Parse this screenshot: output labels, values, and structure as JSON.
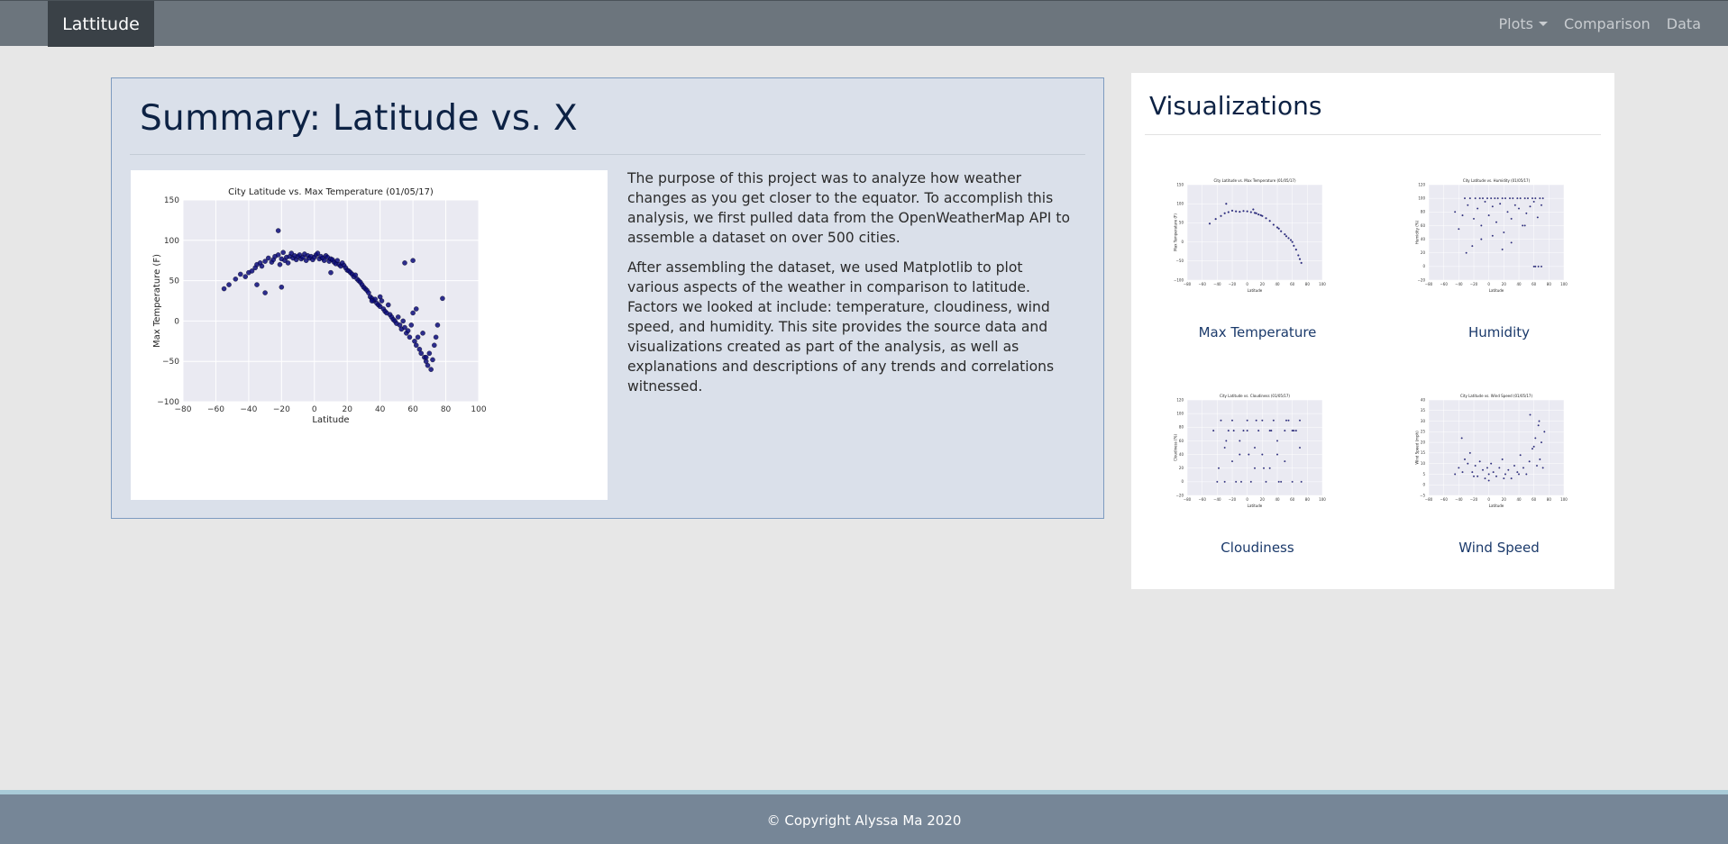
{
  "navbar": {
    "brand": "Lattitude",
    "links": [
      {
        "label": "Plots"
      },
      {
        "label": "Comparison"
      },
      {
        "label": "Data"
      }
    ]
  },
  "summary": {
    "title": "Summary: Latitude vs. X",
    "paragraphs": [
      "The purpose of this project was to analyze how weather changes as you get closer to the equator. To accomplish this analysis, we first pulled data from the OpenWeatherMap API to assemble a dataset on over 500 cities.",
      "After assembling the dataset, we used Matplotlib to plot various aspects of the weather in comparison to latitude. Factors we looked at include: temperature, cloudiness, wind speed, and humidity. This site provides the source data and visualizations created as part of the analysis, as well as explanations and descriptions of any trends and correlations witnessed."
    ]
  },
  "visualizations": {
    "title": "Visualizations",
    "items": [
      {
        "label": "Max Temperature"
      },
      {
        "label": "Humidity"
      },
      {
        "label": "Cloudiness"
      },
      {
        "label": "Wind Speed"
      }
    ]
  },
  "footer": {
    "text": "© Copyright Alyssa Ma 2020"
  },
  "colors": {
    "point": "#0b0b7a",
    "plot_bg": "#eaeaf2",
    "grid": "#ffffff"
  },
  "chart_data": [
    {
      "type": "scatter",
      "title": "City Latitude vs. Max Temperature (01/05/17)",
      "xlabel": "Latitude",
      "ylabel": "Max Temperature (F)",
      "xlim": [
        -80,
        100
      ],
      "ylim": [
        -100,
        150
      ],
      "xticks": [
        -80,
        -60,
        -40,
        -20,
        0,
        20,
        40,
        60,
        80,
        100
      ],
      "yticks": [
        -100,
        -50,
        0,
        50,
        100,
        150
      ],
      "trend": "peaks near 80 F around latitude 0-10, dropping toward -50 F near latitude 70",
      "x": [
        -55,
        -52,
        -48,
        -45,
        -42,
        -40,
        -38,
        -36,
        -35,
        -33,
        -32,
        -30,
        -28,
        -26,
        -25,
        -24,
        -22,
        -21,
        -20,
        -19,
        -18,
        -17,
        -16,
        -15,
        -14,
        -13,
        -12,
        -11,
        -10,
        -9,
        -8,
        -7,
        -6,
        -5,
        -4,
        -3,
        -2,
        -1,
        0,
        1,
        2,
        3,
        4,
        5,
        6,
        7,
        8,
        9,
        10,
        11,
        12,
        13,
        14,
        15,
        16,
        17,
        18,
        19,
        20,
        21,
        22,
        23,
        24,
        25,
        26,
        27,
        28,
        29,
        30,
        31,
        32,
        33,
        34,
        35,
        36,
        37,
        38,
        39,
        40,
        41,
        42,
        43,
        44,
        45,
        46,
        47,
        48,
        49,
        50,
        51,
        52,
        53,
        54,
        55,
        56,
        57,
        58,
        59,
        60,
        61,
        62,
        63,
        64,
        65,
        66,
        67,
        68,
        69,
        70,
        71,
        72,
        73,
        74,
        75,
        78,
        -22,
        -30,
        -35,
        -20,
        10,
        60,
        55,
        40,
        35,
        62,
        68
      ],
      "y": [
        40,
        45,
        52,
        58,
        55,
        60,
        62,
        66,
        70,
        72,
        68,
        74,
        78,
        73,
        76,
        80,
        82,
        70,
        77,
        85,
        75,
        79,
        72,
        80,
        84,
        78,
        81,
        76,
        80,
        82,
        77,
        79,
        83,
        75,
        81,
        78,
        80,
        76,
        79,
        82,
        84,
        77,
        80,
        78,
        75,
        81,
        79,
        74,
        77,
        76,
        73,
        71,
        75,
        70,
        68,
        72,
        69,
        66,
        63,
        62,
        60,
        58,
        55,
        57,
        52,
        50,
        48,
        45,
        42,
        40,
        38,
        35,
        30,
        28,
        25,
        27,
        22,
        20,
        18,
        25,
        15,
        12,
        10,
        20,
        8,
        5,
        2,
        0,
        -3,
        5,
        -5,
        -10,
        0,
        -8,
        -15,
        -12,
        -20,
        -5,
        10,
        -25,
        -30,
        -20,
        -35,
        -40,
        -15,
        -45,
        -50,
        -55,
        -40,
        -60,
        -48,
        -30,
        -20,
        -5,
        28,
        112,
        35,
        45,
        42,
        60,
        75,
        72,
        30,
        25,
        15,
        -45
      ]
    },
    {
      "type": "scatter",
      "title": "City Latitude vs. Max Temperature (01/05/17)",
      "xlabel": "Latitude",
      "ylabel": "Max Temperature (F)",
      "xlim": [
        -80,
        100
      ],
      "ylim": [
        -100,
        150
      ],
      "x": [
        -50,
        -42,
        -35,
        -30,
        -25,
        -20,
        -15,
        -10,
        -5,
        0,
        5,
        10,
        15,
        20,
        25,
        30,
        35,
        40,
        45,
        50,
        55,
        60,
        65,
        68,
        70,
        72,
        -28,
        8,
        12,
        18,
        42,
        52,
        58,
        62
      ],
      "y": [
        48,
        60,
        68,
        75,
        78,
        82,
        80,
        79,
        81,
        80,
        78,
        76,
        72,
        68,
        62,
        55,
        45,
        38,
        28,
        20,
        10,
        0,
        -20,
        -35,
        -45,
        -55,
        100,
        85,
        75,
        70,
        35,
        15,
        5,
        -10
      ]
    },
    {
      "type": "scatter",
      "title": "City Latitude vs. Humidity (01/05/17)",
      "xlabel": "Latitude",
      "ylabel": "Humidity (%)",
      "xlim": [
        -80,
        100
      ],
      "ylim": [
        -20,
        120
      ],
      "x": [
        -45,
        -40,
        -35,
        -32,
        -28,
        -25,
        -20,
        -18,
        -15,
        -12,
        -10,
        -8,
        -5,
        -2,
        0,
        3,
        5,
        8,
        10,
        12,
        15,
        18,
        20,
        22,
        25,
        28,
        30,
        32,
        35,
        38,
        40,
        42,
        45,
        48,
        50,
        52,
        55,
        58,
        60,
        62,
        65,
        68,
        70,
        72,
        -30,
        -22,
        -10,
        5,
        18,
        30,
        48,
        60,
        62,
        66,
        70
      ],
      "y": [
        80,
        55,
        75,
        100,
        90,
        100,
        70,
        100,
        85,
        100,
        60,
        100,
        95,
        100,
        75,
        100,
        88,
        100,
        65,
        100,
        92,
        100,
        50,
        100,
        80,
        100,
        70,
        100,
        90,
        100,
        85,
        100,
        60,
        100,
        78,
        100,
        88,
        100,
        95,
        100,
        72,
        100,
        90,
        100,
        20,
        30,
        40,
        45,
        25,
        35,
        60,
        0,
        0,
        0,
        0
      ]
    },
    {
      "type": "scatter",
      "title": "City Latitude vs. Cloudiness (01/05/17)",
      "xlabel": "Latitude",
      "ylabel": "Cloudiness (%)",
      "xlim": [
        -80,
        100
      ],
      "ylim": [
        -20,
        120
      ],
      "x": [
        -45,
        -40,
        -35,
        -30,
        -25,
        -20,
        -15,
        -10,
        -5,
        0,
        5,
        10,
        15,
        20,
        25,
        30,
        35,
        40,
        45,
        50,
        55,
        60,
        65,
        70,
        -38,
        -28,
        -18,
        -8,
        2,
        12,
        22,
        32,
        42,
        52,
        62,
        72,
        -30,
        -20,
        -10,
        0,
        10,
        20,
        30,
        40,
        50,
        60,
        70
      ],
      "y": [
        75,
        0,
        90,
        0,
        75,
        90,
        0,
        40,
        75,
        90,
        0,
        20,
        75,
        90,
        0,
        75,
        90,
        40,
        0,
        75,
        90,
        0,
        75,
        90,
        20,
        60,
        75,
        0,
        40,
        90,
        20,
        75,
        0,
        90,
        75,
        0,
        50,
        30,
        60,
        75,
        50,
        40,
        20,
        60,
        30,
        75,
        50
      ]
    },
    {
      "type": "scatter",
      "title": "City Latitude vs. Wind Speed (01/05/17)",
      "xlabel": "Latitude",
      "ylabel": "Wind Speed (mph)",
      "xlim": [
        -80,
        100
      ],
      "ylim": [
        -5,
        40
      ],
      "x": [
        -45,
        -40,
        -36,
        -32,
        -28,
        -25,
        -22,
        -18,
        -15,
        -12,
        -8,
        -5,
        -2,
        0,
        3,
        6,
        10,
        14,
        18,
        22,
        26,
        30,
        34,
        38,
        42,
        46,
        50,
        54,
        58,
        62,
        64,
        66,
        68,
        70,
        72,
        74,
        -35,
        -20,
        0,
        20,
        40,
        55,
        60,
        67
      ],
      "y": [
        5,
        8,
        22,
        12,
        10,
        15,
        6,
        9,
        4,
        11,
        7,
        3,
        8,
        5,
        10,
        6,
        4,
        8,
        12,
        5,
        7,
        3,
        9,
        6,
        14,
        8,
        5,
        11,
        17,
        22,
        9,
        28,
        12,
        20,
        8,
        25,
        6,
        4,
        2,
        3,
        5,
        33,
        18,
        30
      ]
    }
  ]
}
